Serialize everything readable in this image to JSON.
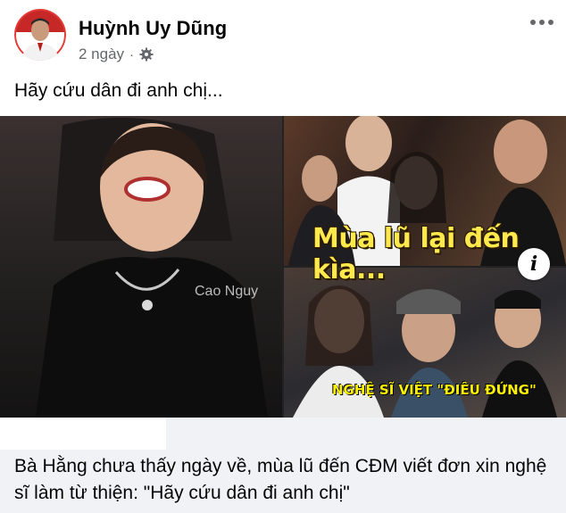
{
  "post": {
    "author_name": "Huỳnh Uy Dũng",
    "time": "2 ngày",
    "separator": "·",
    "caption": "Hãy cứu dân đi anh chị..."
  },
  "media": {
    "watermark": "Cao Nguy",
    "overlay_title": "Mùa lũ lại đến kìa...",
    "overlay_subtitle": "NGHỆ SĨ VIỆT \"ĐIÊU ĐỨNG\""
  },
  "link": {
    "title": "Bà Hằng chưa thấy ngày về, mùa lũ đến CĐM viết đơn xin nghệ sĩ làm từ thiện: \"Hãy cứu dân đi anh chị\""
  },
  "icons": {
    "more": "more-horizontal-icon",
    "privacy": "gear-icon",
    "info": "info-icon"
  },
  "colors": {
    "secondary_text": "#65676b",
    "card_background": "#f0f2f5",
    "overlay_yellow": "#ffe94d"
  }
}
